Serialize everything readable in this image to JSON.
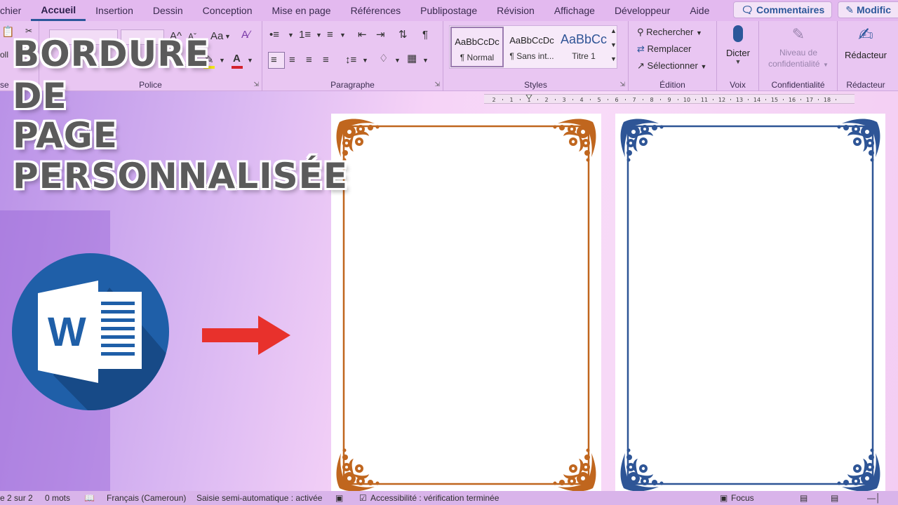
{
  "tabs": [
    "chier",
    "Accueil",
    "Insertion",
    "Dessin",
    "Conception",
    "Mise en page",
    "Références",
    "Publipostage",
    "Révision",
    "Affichage",
    "Développeur",
    "Aide"
  ],
  "active_tab": "Accueil",
  "comments_label": "Commentaires",
  "edit_label": "Modific",
  "groups": {
    "clipboard": "se",
    "police": "Police",
    "paragraphe": "Paragraphe",
    "styles": "Styles",
    "edition": "Édition",
    "voix": "Voix",
    "confidentialite": "Confidentialité",
    "redacteur": "Rédacteur"
  },
  "clipboard_label": "oll",
  "font_size_label": "Aa",
  "styles": [
    {
      "sample": "AaBbCcDc",
      "name": "¶ Normal"
    },
    {
      "sample": "AaBbCcDc",
      "name": "¶ Sans int..."
    },
    {
      "sample": "AaBbCc",
      "name": "Titre 1"
    }
  ],
  "edition": {
    "find": "Rechercher",
    "replace": "Remplacer",
    "select": "Sélectionner"
  },
  "dicter": "Dicter",
  "sensitivity": [
    "Niveau de",
    "confidentialité"
  ],
  "redacteur_btn": "Rédacteur",
  "ruler_numbers": [
    "2",
    "1",
    "1",
    "2",
    "3",
    "4",
    "5",
    "6",
    "7",
    "8",
    "9",
    "10",
    "11",
    "12",
    "13",
    "14",
    "15",
    "16",
    "17",
    "18"
  ],
  "title_lines": [
    "BORDURE",
    "DE",
    "PAGE",
    "PERSONNALISÉE"
  ],
  "logo_letter": "W",
  "colors": {
    "orange_border": "#c0661e",
    "blue_border": "#2e5596",
    "arrow": "#e8312c",
    "word_blue": "#1f5fa8"
  },
  "status": {
    "page": "e 2 sur 2",
    "words": "0 mots",
    "language": "Français (Cameroun)",
    "autocomplete": "Saisie semi-automatique : activée",
    "accessibility": "Accessibilité : vérification terminée",
    "focus": "Focus"
  }
}
